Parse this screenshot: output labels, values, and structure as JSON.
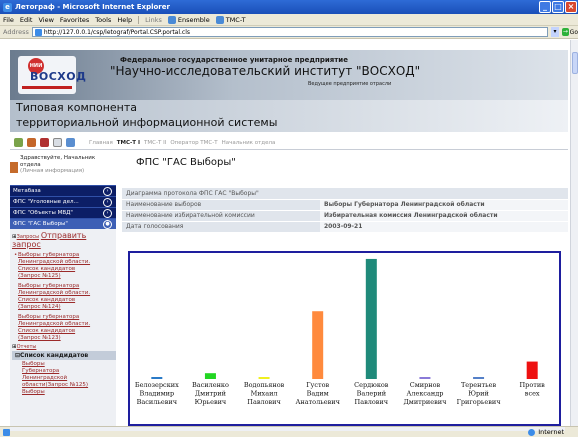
{
  "window": {
    "title": "Летограф - Microsoft Internet Explorer",
    "min": "_",
    "max": "□",
    "close": "×"
  },
  "menu": {
    "items": [
      "File",
      "Edit",
      "View",
      "Favorites",
      "Tools",
      "Help"
    ],
    "links_label": "Links",
    "link1": "Ensemble",
    "link2": "TMC-T"
  },
  "address": {
    "label": "Address",
    "url": "http://127.0.0.1/csp/letograf/Portal.CSP.portal.cls",
    "go": "Go"
  },
  "banner": {
    "logo_small": "НИИ",
    "logo": "ВОСХОД",
    "line1": "Федеральное государственное унитарное предприятие",
    "line2": "\"Научно-исследовательский институт \"ВОСХОД\"",
    "line3": "Ведущее предприятие отрасли"
  },
  "system_name": {
    "line1": "Типовая компонента",
    "line2": "территориальной информационной системы"
  },
  "nav": {
    "breadcrumbs": [
      "Главная",
      "ТМС-Т I",
      "ТМС-Т II",
      "Оператор ТМС-Т",
      "Начальник отдела"
    ]
  },
  "user": {
    "greeting": "Здравствуйте, Начальник",
    "role": "отдела",
    "info": "(Личная информация)"
  },
  "sidebar": {
    "tabs": [
      "Метабаза",
      "ФПС \"Уголовные дел...",
      "ФПС \"Объекты МВД\"",
      "ФПС \"ГАС Выборы\""
    ],
    "tree": {
      "requests_small": "Запросы",
      "send_request": "Отправить запрос",
      "items": [
        [
          "Выборы губернатора",
          "Ленинградской области.",
          "Список кандидатов",
          "(Запрос №125)"
        ],
        [
          "Выборы губернатора",
          "Ленинградской области.",
          "Список кандидатов",
          "(Запрос №124)"
        ],
        [
          "Выборы губернатора",
          "Ленинградской области.",
          "Список кандидатов",
          "(Запрос №123)"
        ]
      ],
      "reports": "Отчеты",
      "candidates": "Список кандидатов",
      "report_item": [
        "Выборы",
        "Губернатора",
        "Ленинградской",
        "области(Запрос №125)"
      ],
      "report_item2": "Выборы"
    }
  },
  "main": {
    "title": "ФПС \"ГАС Выборы\"",
    "table": {
      "header": "Диаграмма протокола ФПС ГАС \"Выборы\"",
      "rows": [
        {
          "key": "Наименование выборов",
          "value": "Выборы Губернатора Ленинградской области"
        },
        {
          "key": "Наименование избирательной комиссии",
          "value": "Избирательная комиссия Ленинградской области"
        },
        {
          "key": "Дата голосования",
          "value": "2003-09-21"
        }
      ]
    }
  },
  "chart_data": {
    "type": "bar",
    "categories": [
      [
        "Белозерских",
        "Владимир",
        "Васильевич"
      ],
      [
        "Василенко",
        "Дмитрий",
        "Юрьевич"
      ],
      [
        "Водопьянов",
        "Михаил",
        "Павлович"
      ],
      [
        "Густов",
        "Вадим",
        "Анатольевич"
      ],
      [
        "Сердюков",
        "Валерий",
        "Павлович"
      ],
      [
        "Смирнов",
        "Александр",
        "Дмитриевич"
      ],
      [
        "Терентьев",
        "Юрий",
        "Григорьевич"
      ],
      [
        "Против",
        "всех"
      ]
    ],
    "values": [
      1,
      3,
      1,
      35,
      62,
      1,
      1,
      9
    ],
    "colors": [
      "#2a7ac7",
      "#22d622",
      "#f0f020",
      "#ff8a3d",
      "#1f8a7a",
      "#8a7ad8",
      "#5580c8",
      "#ee1111"
    ],
    "ylim": [
      0,
      63
    ],
    "grid": false,
    "title": "",
    "xlabel": "",
    "ylabel": ""
  },
  "status": {
    "zone": "Internet"
  }
}
